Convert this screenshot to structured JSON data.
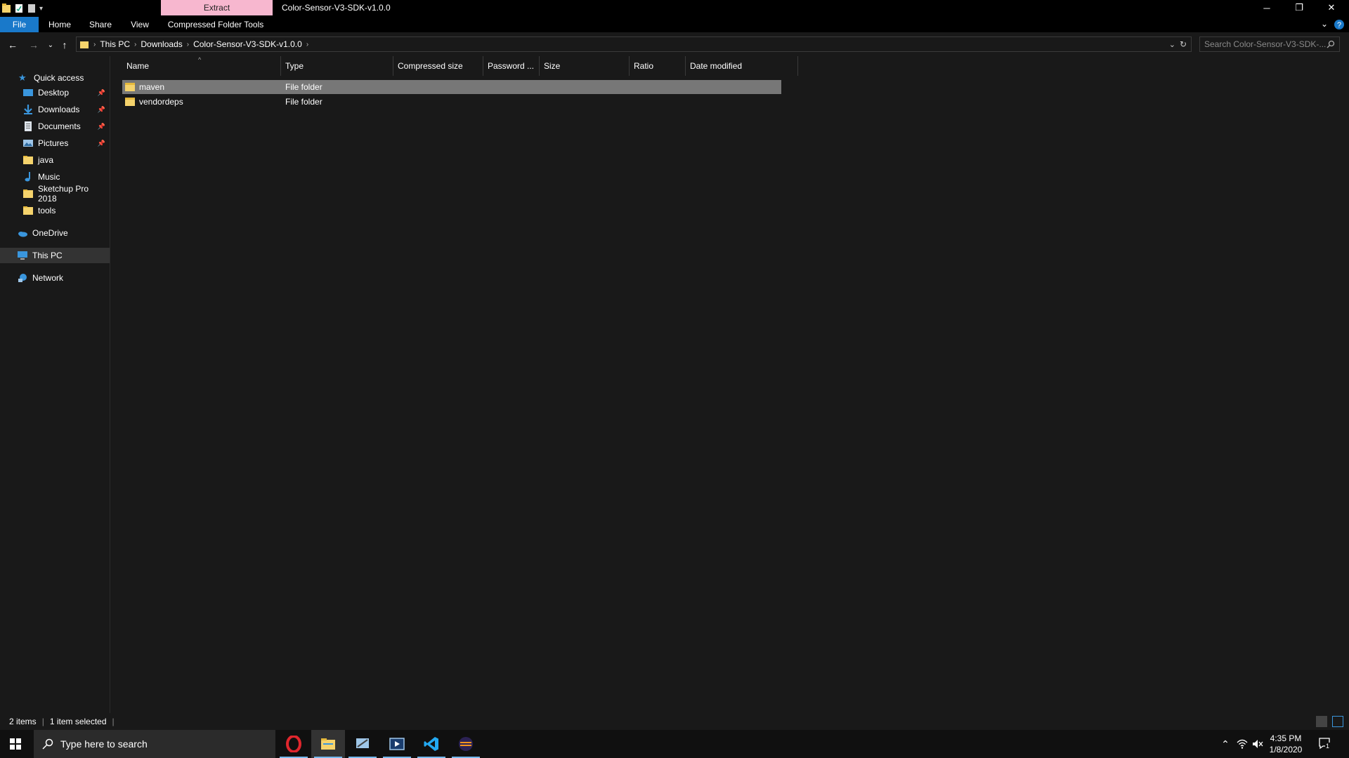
{
  "window": {
    "title": "Color-Sensor-V3-SDK-v1.0.0",
    "context_tab": "Extract",
    "controls": {
      "minimize": "─",
      "restore": "❐",
      "close": "✕"
    }
  },
  "ribbon": {
    "tabs": [
      "File",
      "Home",
      "Share",
      "View",
      "Compressed Folder Tools"
    ]
  },
  "address": {
    "crumbs": [
      "This PC",
      "Downloads",
      "Color-Sensor-V3-SDK-v1.0.0"
    ],
    "search_placeholder": "Search Color-Sensor-V3-SDK-..."
  },
  "sidebar": {
    "quick_access": "Quick access",
    "items": [
      {
        "label": "Desktop",
        "icon": "desktop-icon",
        "pinned": true
      },
      {
        "label": "Downloads",
        "icon": "download-icon",
        "pinned": true
      },
      {
        "label": "Documents",
        "icon": "documents-icon",
        "pinned": true
      },
      {
        "label": "Pictures",
        "icon": "pictures-icon",
        "pinned": true
      },
      {
        "label": "java",
        "icon": "folder-icon",
        "pinned": false
      },
      {
        "label": "Music",
        "icon": "music-icon",
        "pinned": false
      },
      {
        "label": "Sketchup Pro 2018",
        "icon": "folder-icon",
        "pinned": false
      },
      {
        "label": "tools",
        "icon": "folder-icon",
        "pinned": false
      }
    ],
    "onedrive": "OneDrive",
    "this_pc": "This PC",
    "network": "Network"
  },
  "columns": [
    "Name",
    "Type",
    "Compressed size",
    "Password ...",
    "Size",
    "Ratio",
    "Date modified"
  ],
  "files": [
    {
      "name": "maven",
      "type": "File folder",
      "selected": true
    },
    {
      "name": "vendordeps",
      "type": "File folder",
      "selected": false
    }
  ],
  "status": {
    "count": "2 items",
    "selected": "1 item selected"
  },
  "taskbar": {
    "search_placeholder": "Type here to search",
    "time": "4:35 PM",
    "date": "1/8/2020",
    "notification_count": "1"
  },
  "colors": {
    "accent": "#1979ca",
    "context_tab": "#f7b7cf",
    "folder": "#f5d36c"
  }
}
